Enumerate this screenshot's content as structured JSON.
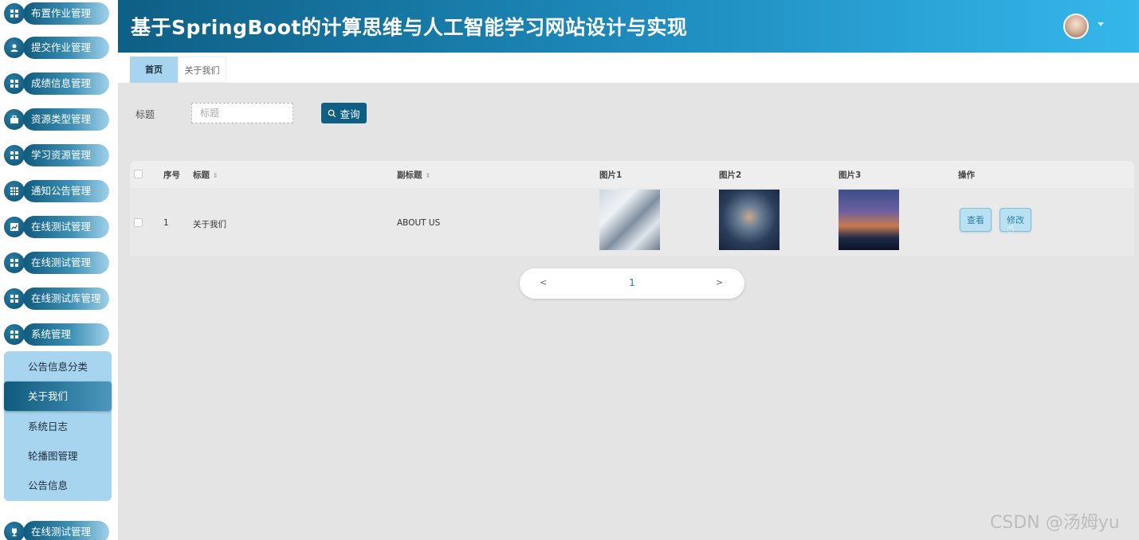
{
  "header": {
    "title": "基于SpringBoot的计算思维与人工智能学习网站设计与实现"
  },
  "sidebar": {
    "items": [
      {
        "label": "布置作业管理",
        "icon": "grid-icon"
      },
      {
        "label": "提交作业管理",
        "icon": "user-icon"
      },
      {
        "label": "成绩信息管理",
        "icon": "grid-icon"
      },
      {
        "label": "资源类型管理",
        "icon": "briefcase-icon"
      },
      {
        "label": "学习资源管理",
        "icon": "grid-icon"
      },
      {
        "label": "通知公告管理",
        "icon": "table-icon"
      },
      {
        "label": "在线测试管理",
        "icon": "chart-icon"
      },
      {
        "label": "在线测试管理",
        "icon": "grid-icon"
      },
      {
        "label": "在线测试库管理",
        "icon": "grid-icon"
      },
      {
        "label": "系统管理",
        "icon": "grid-icon"
      }
    ],
    "submenu": [
      {
        "label": "公告信息分类"
      },
      {
        "label": "关于我们"
      },
      {
        "label": "系统日志"
      },
      {
        "label": "轮播图管理"
      },
      {
        "label": "公告信息"
      }
    ],
    "bottom_item": {
      "label": "在线测试管理",
      "icon": "trophy-icon"
    }
  },
  "tabs": [
    {
      "label": "首页"
    },
    {
      "label": "关于我们"
    }
  ],
  "search": {
    "label": "标题",
    "placeholder": "标题",
    "button_label": "查询"
  },
  "table": {
    "headers": {
      "index": "序号",
      "title": "标题",
      "subtitle": "副标题",
      "pic1": "图片1",
      "pic2": "图片2",
      "pic3": "图片3",
      "actions": "操作"
    },
    "rows": [
      {
        "index": "1",
        "title": "关于我们",
        "subtitle": "ABOUT US",
        "view_label": "查看",
        "edit_label": "修改"
      }
    ]
  },
  "pagination": {
    "prev": "<",
    "page": "1",
    "next": ">"
  },
  "watermark": "CSDN @汤姆yu"
}
